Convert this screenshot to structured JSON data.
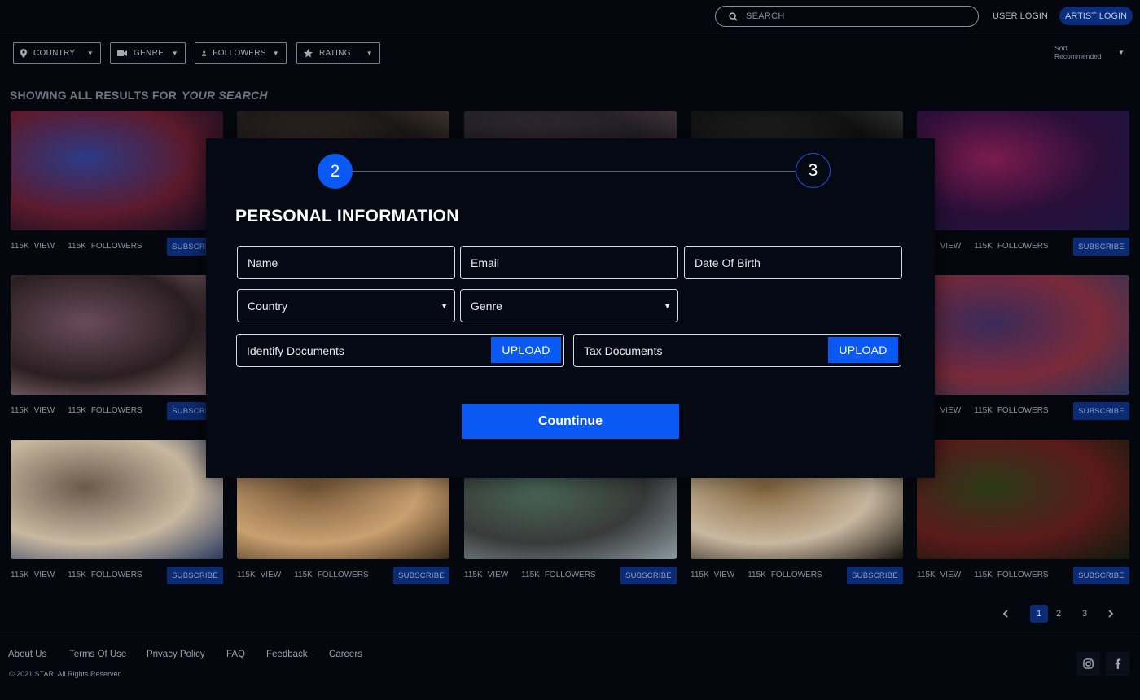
{
  "header": {
    "search_placeholder": "SEARCH",
    "user_login": "USER LOGIN",
    "artist_login": "ARTIST LOGIN"
  },
  "filters": [
    {
      "label": "COUNTRY",
      "icon": "location-pin-icon"
    },
    {
      "label": "GENRE",
      "icon": "video-camera-icon"
    },
    {
      "label": "FOLLOWERS",
      "icon": "person-icon"
    },
    {
      "label": "RATING",
      "icon": "star-icon"
    }
  ],
  "sort": {
    "label": "Sort",
    "value": "Recommended"
  },
  "results": {
    "prefix": "SHOWING ALL RESULTS FOR",
    "query": "YOUR SEARCH"
  },
  "card_stats": {
    "views": "115K",
    "views_label": "VIEW",
    "followers": "115K",
    "followers_label": "FOLLOWERS",
    "subscribe": "SUBSCRIBE"
  },
  "modal": {
    "step_current": "2",
    "step_next": "3",
    "title": "PERSONAL INFORMATION",
    "name_placeholder": "Name",
    "email_placeholder": "Email",
    "dob_placeholder": "Date Of Birth",
    "country_select": "Country",
    "genre_select": "Genre",
    "identify_documents": "Identify Documents",
    "tax_documents": "Tax Documents",
    "upload_label": "UPLOAD",
    "continue_label": "Countinue"
  },
  "pagination": {
    "pages": [
      "1",
      "2",
      "3"
    ],
    "active": "1"
  },
  "footer": {
    "links": [
      "About Us",
      "Terms Of Use",
      "Privacy Policy",
      "FAQ",
      "Feedback",
      "Careers"
    ],
    "copyright": "© 2021 STAR. All Rights Reserved.",
    "social": [
      "instagram-icon",
      "facebook-icon"
    ]
  },
  "colors": {
    "accent": "#0a59f5",
    "background": "#05070f",
    "button_dark": "#0b2b74"
  }
}
